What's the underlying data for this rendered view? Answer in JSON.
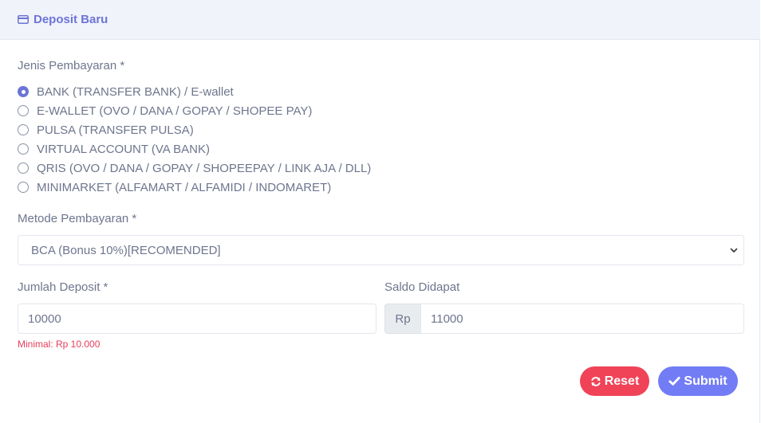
{
  "header": {
    "title": "Deposit Baru",
    "icon": "credit-card-icon"
  },
  "payment_type": {
    "label": "Jenis Pembayaran *",
    "options": [
      {
        "label": "BANK (TRANSFER BANK) / E-wallet",
        "checked": true
      },
      {
        "label": "E-WALLET (OVO / DANA / GOPAY / SHOPEE PAY)",
        "checked": false
      },
      {
        "label": "PULSA (TRANSFER PULSA)",
        "checked": false
      },
      {
        "label": "VIRTUAL ACCOUNT (VA BANK)",
        "checked": false
      },
      {
        "label": "QRIS (OVO / DANA / GOPAY / SHOPEEPAY / LINK AJA / DLL)",
        "checked": false
      },
      {
        "label": "MINIMARKET (ALFAMART / ALFAMIDI / INDOMARET)",
        "checked": false
      }
    ]
  },
  "payment_method": {
    "label": "Metode Pembayaran *",
    "selected": "BCA (Bonus 10%)[RECOMENDED]"
  },
  "deposit_amount": {
    "label": "Jumlah Deposit *",
    "value": "10000",
    "hint": "Minimal: Rp 10.000"
  },
  "balance_received": {
    "label": "Saldo Didapat",
    "prefix": "Rp",
    "value": "11000"
  },
  "actions": {
    "reset_label": "Reset",
    "submit_label": "Submit"
  },
  "colors": {
    "primary": "#727cf5",
    "danger": "#f04358",
    "header_bg": "#f1f3fb",
    "text": "#6e768e"
  }
}
